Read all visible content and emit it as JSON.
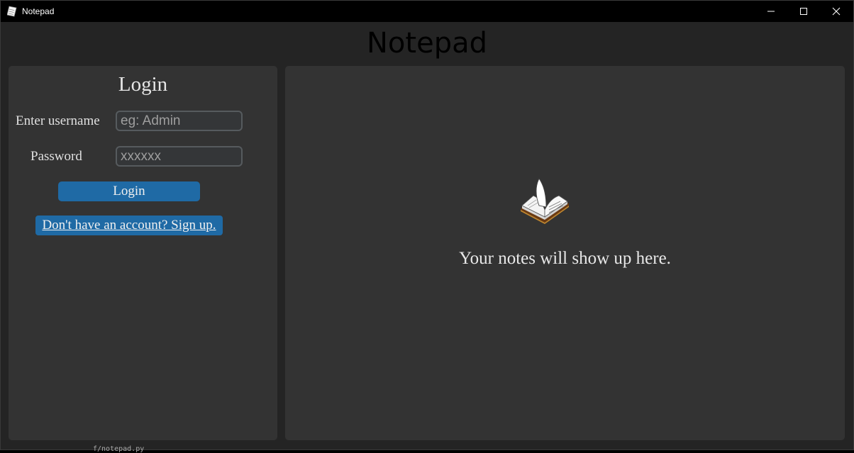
{
  "window": {
    "title": "Notepad",
    "icons": {
      "app": "notepad-icon",
      "minimize": "minimize-icon",
      "maximize": "maximize-icon",
      "close": "close-icon"
    }
  },
  "app": {
    "title": "Notepad"
  },
  "login": {
    "heading": "Login",
    "username_label": "Enter username",
    "username_placeholder": "eg: Admin",
    "username_value": "",
    "password_label": "Password",
    "password_placeholder": "xxxxxx",
    "password_value": "",
    "login_button": "Login",
    "signup_link": "Don't have an account? Sign up."
  },
  "notes": {
    "icon": "open-book-icon",
    "empty_message": "Your notes will show up here."
  },
  "background": {
    "partial_text": "f/notepad.py"
  },
  "colors": {
    "accent": "#1f6aa5",
    "panel": "#333333",
    "window_bg": "#242424",
    "titlebar": "#000000"
  }
}
